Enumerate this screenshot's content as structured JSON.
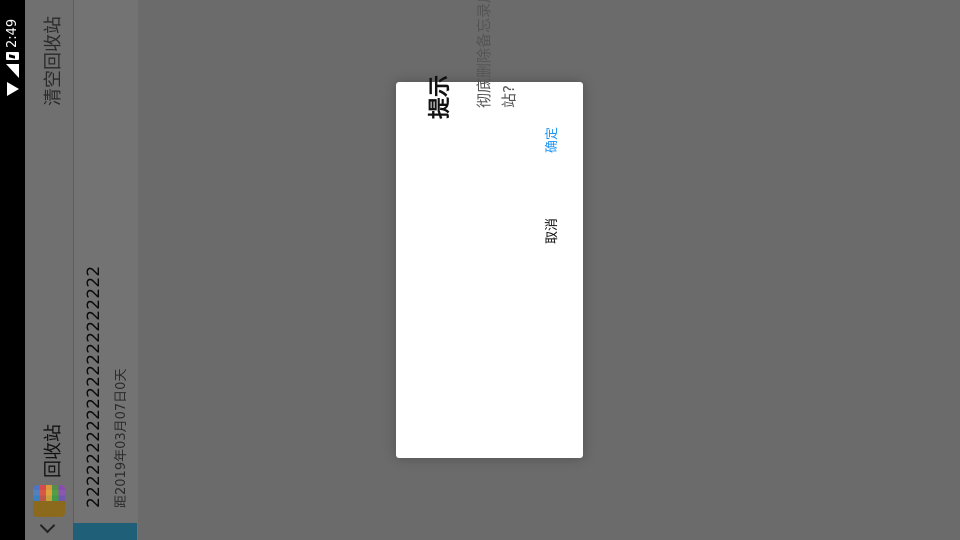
{
  "status_bar": {
    "time": "2:49",
    "icons": [
      "wifi-icon",
      "signal-icon",
      "battery-charging-icon"
    ]
  },
  "toolbar": {
    "title": "回收站",
    "action": "清空回收站",
    "nav_icon": "chevron-down-icon"
  },
  "notes": [
    {
      "title": "2222222222222222222222",
      "meta": "距2019年03月07日0天"
    }
  ],
  "dialog": {
    "title": "提示",
    "message": "彻底删除备忘录后备忘将无法恢复,确定清空回收站?",
    "cancel": "取消",
    "confirm": "确定"
  },
  "colors": {
    "accent": "#2196f3",
    "scrim": "#6e6e6e",
    "selected_bar": "#1f5f78"
  }
}
